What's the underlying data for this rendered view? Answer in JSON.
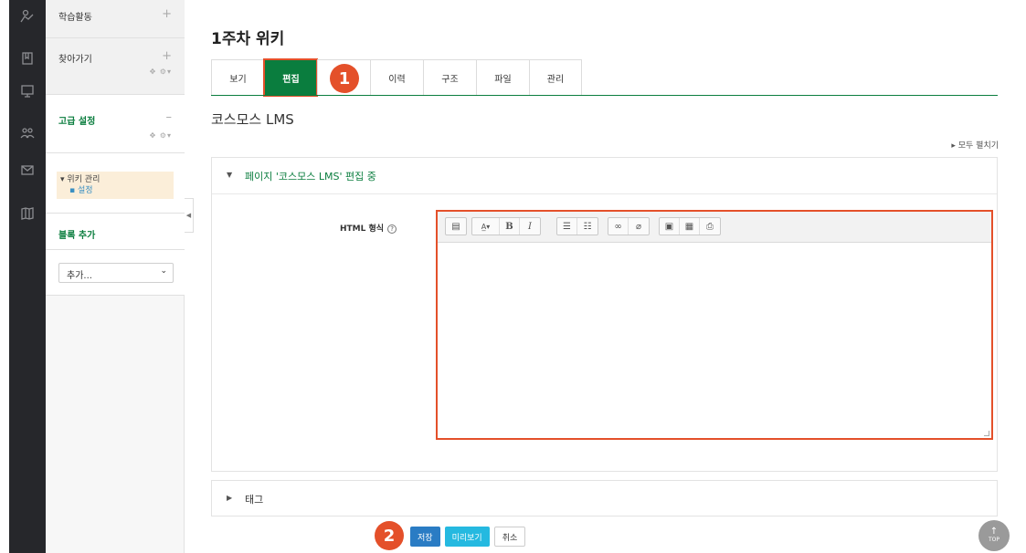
{
  "sidebar": {
    "block_learning": "학습활동",
    "block_navigation": "찾아가기",
    "block_advanced": "고급 설정",
    "tree_root": "위키 관리",
    "tree_child": "설정",
    "block_add_title": "블록 추가",
    "add_select_value": "추가..."
  },
  "page": {
    "title": "1주차 위키",
    "tabs": [
      {
        "label": "보기"
      },
      {
        "label": "편집"
      },
      {
        "label": ""
      },
      {
        "label": "이력"
      },
      {
        "label": "구조"
      },
      {
        "label": "파일"
      },
      {
        "label": "관리"
      }
    ],
    "wiki_title": "코스모스 LMS",
    "expand_all": "▸ 모두 펼치기"
  },
  "editor_section": {
    "header": "페이지 '코스모스 LMS' 편집 중",
    "field_label": "HTML 형식",
    "help_symbol": "?"
  },
  "tags_section": {
    "header": "태그"
  },
  "buttons": {
    "save": "저장",
    "preview": "미리보기",
    "cancel": "취소"
  },
  "annotations": {
    "badge_1": "1",
    "badge_2": "2"
  },
  "back_to_top": {
    "arrow": "↑",
    "label": "TOP"
  },
  "colors": {
    "accent_green": "#0a7d3e",
    "highlight_red": "#e4502a",
    "save_blue": "#2a7cc4",
    "preview_cyan": "#25b9e0",
    "rail_dark": "#26272b"
  }
}
